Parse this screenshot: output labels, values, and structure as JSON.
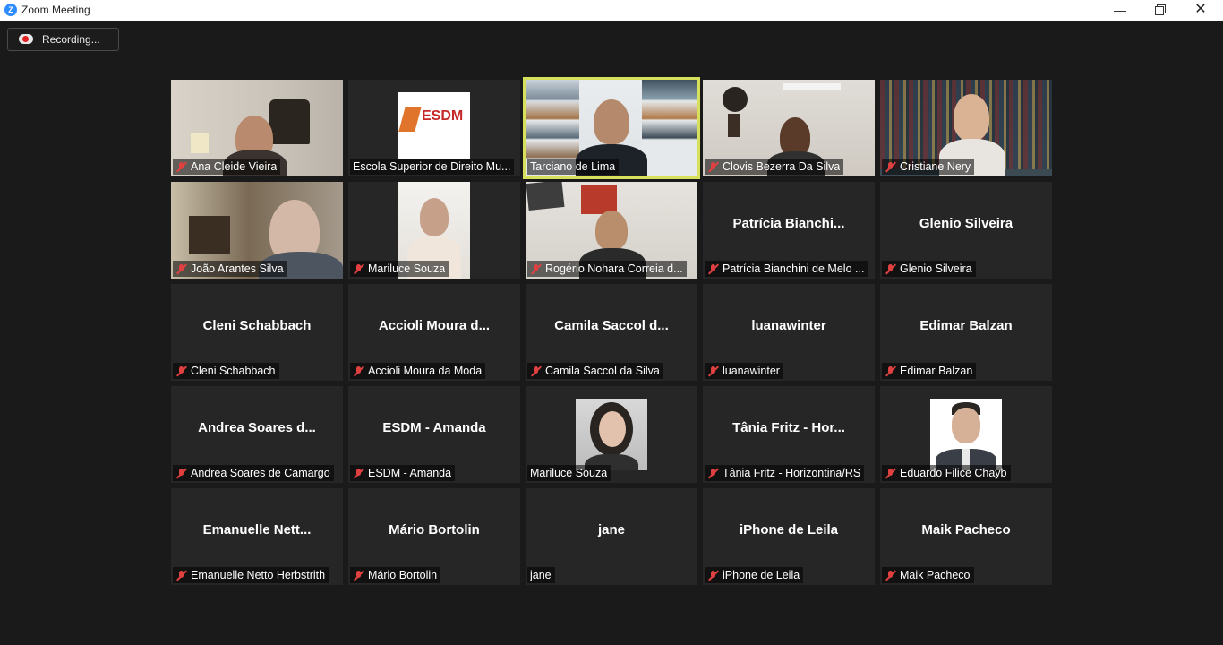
{
  "window": {
    "title": "Zoom Meeting",
    "app_icon": "zoom-logo",
    "controls": {
      "minimize": "—",
      "maximize": "",
      "close": "✕"
    }
  },
  "recording": {
    "label": "Recording...",
    "icon": "recording-cloud-icon"
  },
  "colors": {
    "active_speaker": "#d6e05b",
    "muted": "#e04040",
    "background": "#1a1a1a",
    "tile": "#262626"
  },
  "participants": [
    {
      "name": "Ana Cleide Vieira",
      "muted": true,
      "video": true
    },
    {
      "name": "Escola Superior de Direito Mu...",
      "muted": false,
      "video": true,
      "logo_text": "ESDM"
    },
    {
      "name": "Tarciano de Lima",
      "muted": false,
      "video": true,
      "active": true
    },
    {
      "name": "Clovis Bezerra Da Silva",
      "muted": true,
      "video": true
    },
    {
      "name": "Cristiane Nery",
      "muted": true,
      "video": true
    },
    {
      "name": "João Arantes Silva",
      "muted": true,
      "video": true
    },
    {
      "name": "Mariluce Souza",
      "muted": true,
      "video": true
    },
    {
      "name": "Rogério Nohara Correia d...",
      "muted": true,
      "video": true
    },
    {
      "name": "Patrícia Bianchini de Melo ...",
      "display": "Patrícia  Bianchi...",
      "muted": true,
      "video": false
    },
    {
      "name": "Glenio Silveira",
      "display": "Glenio Silveira",
      "muted": true,
      "video": false
    },
    {
      "name": "Cleni Schabbach",
      "display": "Cleni Schabbach",
      "muted": true,
      "video": false
    },
    {
      "name": "Accioli Moura da Moda",
      "display": "Accioli  Moura  d...",
      "muted": true,
      "video": false
    },
    {
      "name": "Camila Saccol da Silva",
      "display": "Camila  Saccol  d...",
      "muted": true,
      "video": false
    },
    {
      "name": "luanawinter",
      "display": "luanawinter",
      "muted": true,
      "video": false
    },
    {
      "name": "Edimar Balzan",
      "display": "Edimar Balzan",
      "muted": true,
      "video": false
    },
    {
      "name": "Andrea Soares de Camargo",
      "display": "Andrea  Soares  d...",
      "muted": true,
      "video": false
    },
    {
      "name": "ESDM - Amanda",
      "display": "ESDM - Amanda",
      "muted": true,
      "video": false
    },
    {
      "name": "Mariluce Souza",
      "muted": false,
      "video": false,
      "photo": true
    },
    {
      "name": "Tânia Fritz - Horizontina/RS",
      "display": "Tânia  Fritz  -  Hor...",
      "muted": true,
      "video": false
    },
    {
      "name": "Eduardo Filice Chayb",
      "muted": true,
      "video": false,
      "photo": true
    },
    {
      "name": "Emanuelle Netto Herbstrith",
      "display": "Emanuelle  Nett...",
      "muted": true,
      "video": false
    },
    {
      "name": "Mário Bortolin",
      "display": "Mário Bortolin",
      "muted": true,
      "video": false
    },
    {
      "name": "jane",
      "display": "jane",
      "muted": false,
      "video": false
    },
    {
      "name": "iPhone de Leila",
      "display": "iPhone de Leila",
      "muted": true,
      "video": false
    },
    {
      "name": "Maik Pacheco",
      "display": "Maik Pacheco",
      "muted": true,
      "video": false
    }
  ]
}
